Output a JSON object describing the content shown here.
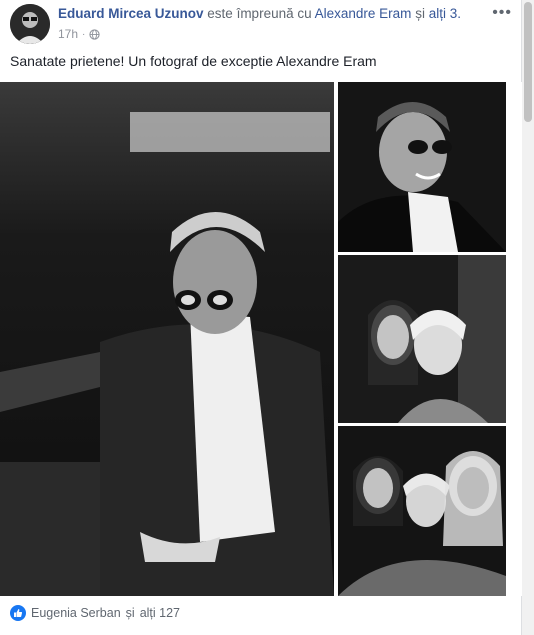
{
  "post": {
    "author": "Eduard Mircea Uzunov",
    "with_prefix": "este împreună cu",
    "tagged_person": "Alexandre Eram",
    "and_text": "și",
    "others_link": "alți 3.",
    "time": "17h",
    "privacy_icon": "globe-icon",
    "text": "Sanatate prietene! Un fotograf de exceptie Alexandre Eram"
  },
  "reactions": {
    "icon": "like-icon",
    "names": "Eugenia Serban",
    "and_text": "și",
    "others": "alți 127"
  },
  "photos": [
    {
      "id": "main",
      "desc": "man-with-glasses-jacket"
    },
    {
      "id": "top-right",
      "desc": "man-with-glasses-smiling"
    },
    {
      "id": "mid-right",
      "desc": "two-women-selfie"
    },
    {
      "id": "bottom-right",
      "desc": "three-women-selfie"
    }
  ],
  "colors": {
    "link": "#385898",
    "secondary_text": "#606770",
    "like_blue": "#1877f2"
  }
}
